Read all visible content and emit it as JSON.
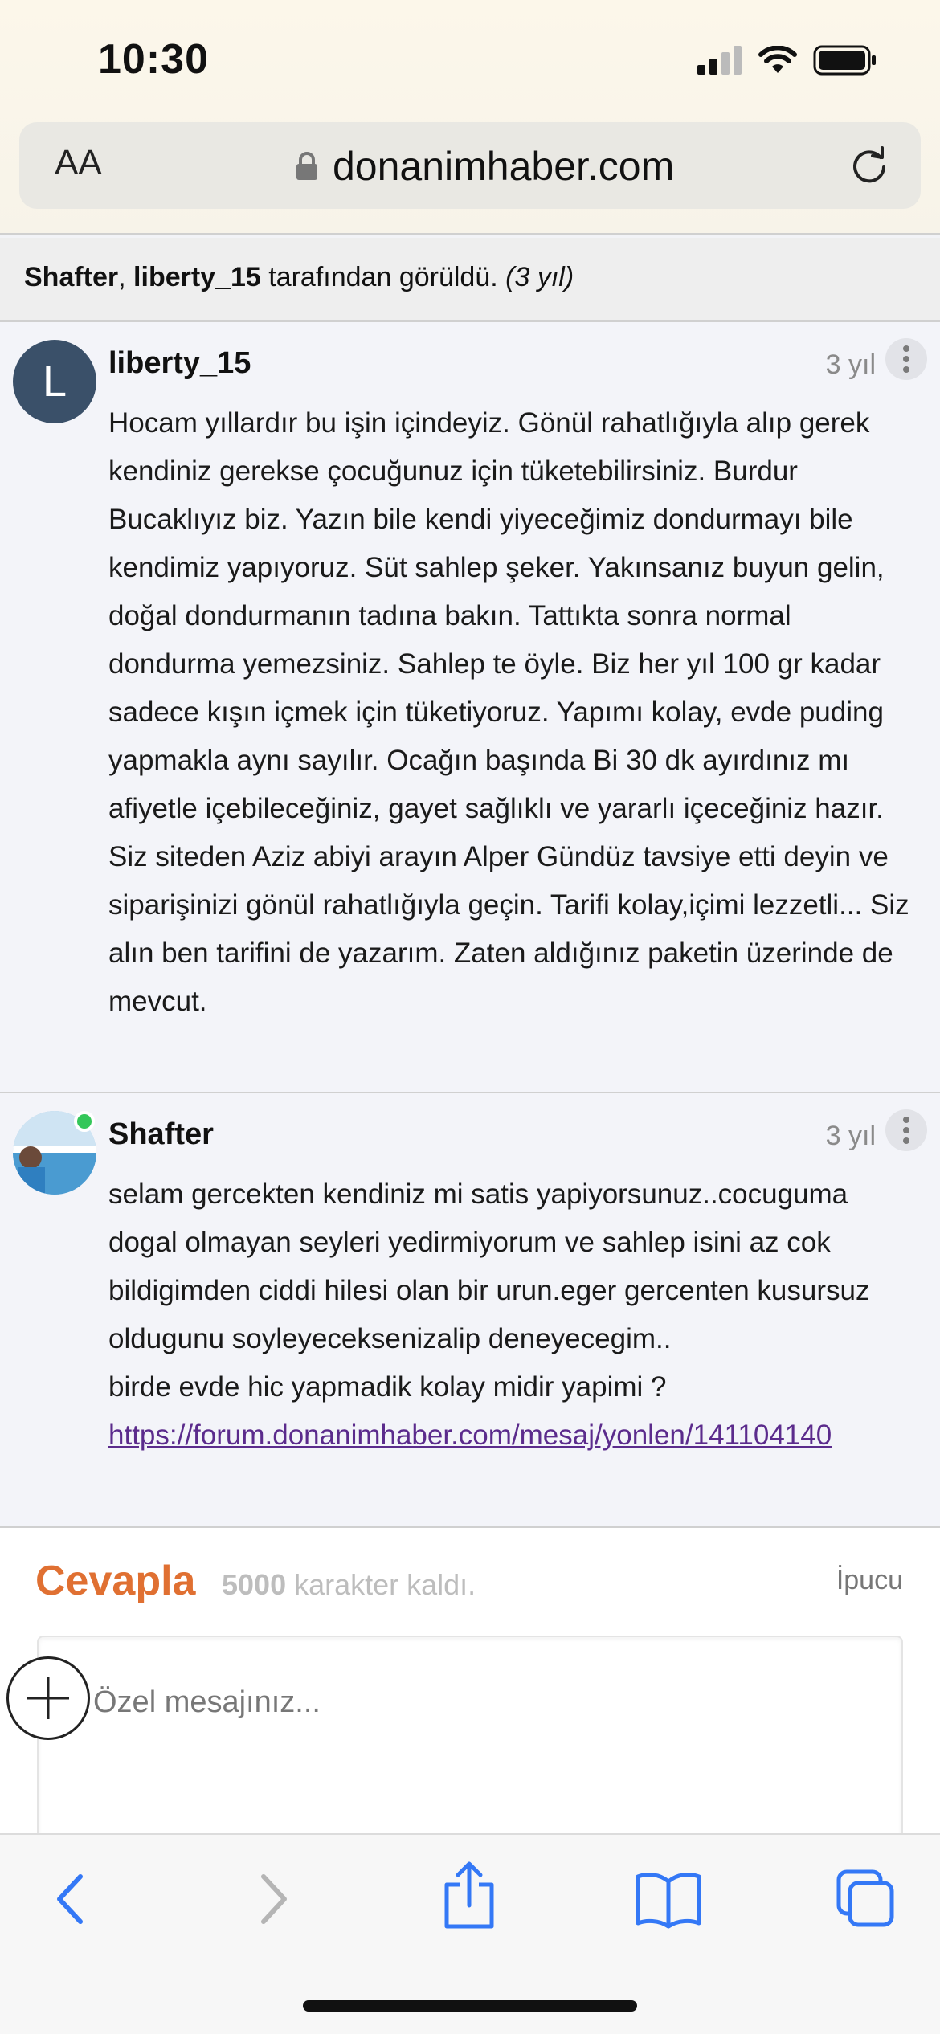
{
  "status_bar": {
    "time": "10:30"
  },
  "address_bar": {
    "text_size_label": "AA",
    "url": "donanimhaber.com"
  },
  "seen_by": {
    "user1": "Shafter",
    "separator": ", ",
    "user2": "liberty_15",
    "suffix": " tarafından görüldü. ",
    "ago": "(3 yıl)"
  },
  "posts": [
    {
      "avatar_letter": "L",
      "username": "liberty_15",
      "ago": "3 yıl",
      "body": "Hocam yıllardır bu işin içindeyiz. Gönül rahatlığıyla alıp gerek kendiniz gerekse çocuğunuz için tüketebilirsiniz. Burdur Bucaklıyız biz. Yazın bile kendi yiyeceğimiz dondurmayı bile kendimiz yapıyoruz. Süt sahlep şeker. Yakınsanız buyun gelin, doğal dondurmanın tadına bakın. Tattıkta sonra normal dondurma yemezsiniz. Sahlep te öyle. Biz her yıl 100 gr kadar sadece kışın içmek için tüketiyoruz. Yapımı kolay, evde puding yapmakla aynı sayılır. Ocağın başında Bi 30 dk ayırdınız mı afiyetle içebileceğiniz, gayet sağlıklı ve yararlı içeceğiniz hazır. Siz siteden Aziz abiyi arayın Alper Gündüz tavsiye etti deyin ve siparişinizi gönül rahatlığıyla geçin. Tarifi kolay,içimi lezzetli... Siz alın ben tarifini de yazarım. Zaten aldığınız paketin üzerinde de mevcut."
    },
    {
      "username": "Shafter",
      "ago": "3 yıl",
      "body_line1": "selam gercekten kendiniz mi satis yapiyorsunuz..cocuguma dogal olmayan seyleri yedirmiyorum ve sahlep isini az cok bildigimden ciddi hilesi olan bir urun.eger gercenten kusursuz oldugunu soyleyeceksenizalip deneyecegim..",
      "body_line2": "birde evde hic yapmadik kolay midir yapimi ?",
      "link": "https://forum.donanimhaber.com/mesaj/yonlen/141104140"
    }
  ],
  "reply": {
    "title": "Cevapla",
    "char_count": "5000",
    "char_suffix": " karakter kaldı.",
    "hint": "İpucu",
    "placeholder": "Özel mesajınız..."
  },
  "colors": {
    "accent": "#e07032",
    "link": "#5b2b8c",
    "ios_blue": "#3478f6",
    "online": "#34c759"
  }
}
